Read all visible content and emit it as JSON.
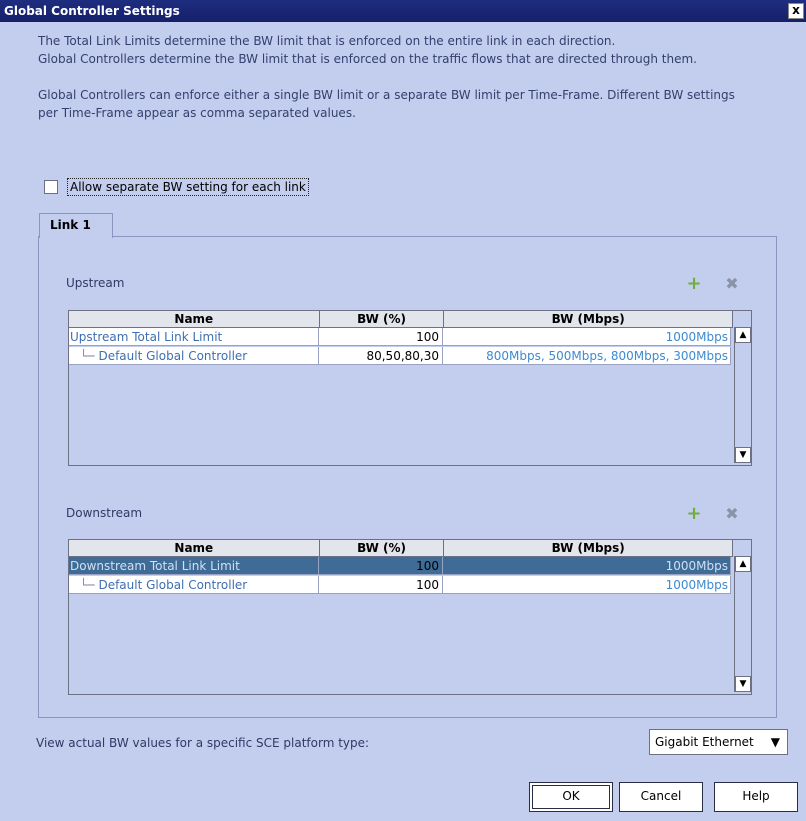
{
  "window": {
    "title": "Global Controller Settings",
    "close": "x"
  },
  "intro": {
    "line1": "The Total Link Limits determine the BW limit that is enforced on the entire link in each direction.",
    "line2": "Global Controllers determine the BW limit that is enforced on the traffic flows that are directed through them.",
    "line3": "Global Controllers can enforce either a single BW limit or a separate BW limit per Time-Frame. Different BW settings",
    "line4": "per Time-Frame appear as comma separated values."
  },
  "checkbox": {
    "label": "Allow separate BW setting for each link",
    "checked": false
  },
  "tab": {
    "label": "Link 1"
  },
  "columns": {
    "name": "Name",
    "bw_pct": "BW (%)",
    "bw_mbps": "BW (Mbps)"
  },
  "upstream": {
    "label": "Upstream",
    "rows": [
      {
        "name": "Upstream Total Link Limit",
        "bw_pct": "100",
        "bw_mbps": "1000Mbps"
      },
      {
        "name": "Default Global Controller",
        "bw_pct": "80,50,80,30",
        "bw_mbps": "800Mbps, 500Mbps, 800Mbps, 300Mbps"
      }
    ]
  },
  "downstream": {
    "label": "Downstream",
    "rows": [
      {
        "name": "Downstream Total Link Limit",
        "bw_pct": "100",
        "bw_mbps": "1000Mbps",
        "selected": true
      },
      {
        "name": "Default Global Controller",
        "bw_pct": "100",
        "bw_mbps": "1000Mbps"
      }
    ]
  },
  "footer": {
    "label": "View actual BW values for a specific SCE platform type:",
    "platform": "Gigabit Ethernet"
  },
  "buttons": {
    "ok": "OK",
    "cancel": "Cancel",
    "help": "Help"
  },
  "colors": {
    "titlebar": "#1f2d80",
    "background": "#c3cdee",
    "selected_row": "#3e6c97",
    "link_text": "#3d6fb0"
  }
}
